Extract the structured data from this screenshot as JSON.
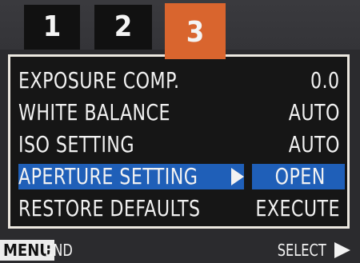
{
  "tabs": [
    {
      "label": "1",
      "active": false
    },
    {
      "label": "2",
      "active": false
    },
    {
      "label": "3",
      "active": true
    }
  ],
  "menu": {
    "items": [
      {
        "label": "EXPOSURE COMP.",
        "value": "0.0",
        "selected": false
      },
      {
        "label": "WHITE BALANCE",
        "value": "AUTO",
        "selected": false
      },
      {
        "label": "ISO SETTING",
        "value": "AUTO",
        "selected": false
      },
      {
        "label": "APERTURE SETTING",
        "value": "OPEN",
        "selected": true
      },
      {
        "label": "RESTORE DEFAULTS",
        "value": "EXECUTE",
        "selected": false
      }
    ]
  },
  "footer": {
    "menu_key": "MENU",
    "end_label": "END",
    "select_label": "SELECT",
    "select_icon": "right-triangle-icon"
  },
  "colors": {
    "active_tab": "#d9652e",
    "highlight": "#1f5fb8",
    "panel_border": "#ece8e0",
    "background": "#2b2b2e"
  }
}
